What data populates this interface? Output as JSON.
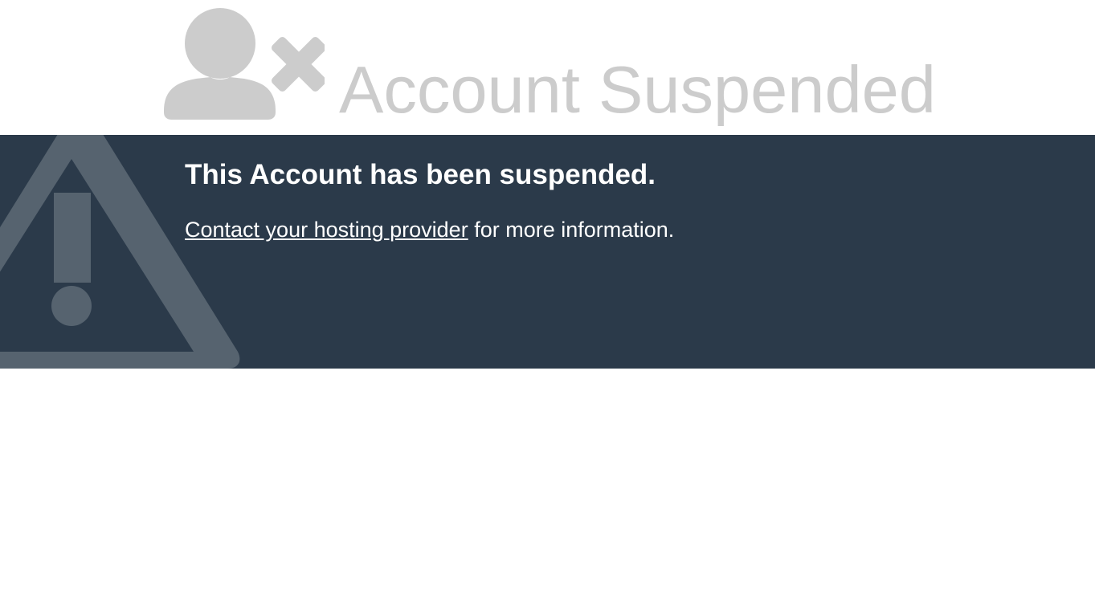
{
  "header": {
    "title": "Account Suspended",
    "icon": "user-blocked-icon",
    "title_color": "#cccccc"
  },
  "banner": {
    "background_color": "#2b3a4a",
    "icon": "warning-triangle-icon",
    "heading": "This Account has been suspended.",
    "link_text": "Contact your hosting provider",
    "message_suffix": " for more information."
  }
}
